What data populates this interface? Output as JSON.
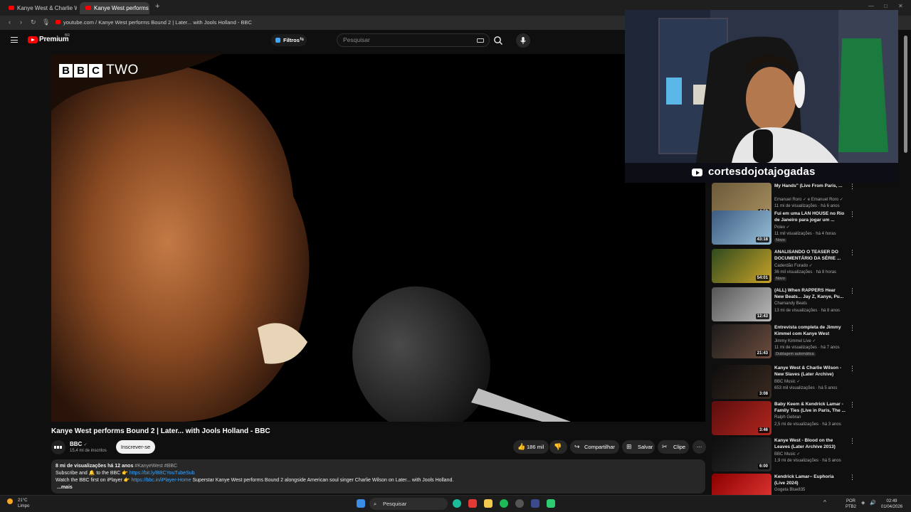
{
  "browser": {
    "tabs": [
      {
        "label": "Kanye West & Charlie Wi"
      },
      {
        "label": "Kanye West performs Bo"
      }
    ],
    "new_tab": "+",
    "url": "youtube.com / Kanye West performs Bound 2 | Later... with Jools Holland - BBC"
  },
  "header": {
    "logo_text": "Premium",
    "logo_region": "BR",
    "filter_label": "Filtros",
    "search_placeholder": "Pesquisar"
  },
  "video": {
    "overlay_logo_letters": [
      "B",
      "B",
      "C"
    ],
    "overlay_logo_suffix": "TWO",
    "title": "Kanye West performs Bound 2 | Later... with Jools Holland - BBC"
  },
  "webcam": {
    "channel_name": "cortesdojotajogadas"
  },
  "channel": {
    "name": "BBC",
    "verified": "✓",
    "subscribers": "15,4 mi de inscritos",
    "subscribe_label": "Inscrever-se"
  },
  "actions": {
    "likes": "186 mil",
    "share": "Compartilhar",
    "save": "Salvar",
    "clip": "Clipe",
    "more": "⋯"
  },
  "description": {
    "views_age": "8 mi de visualizações  há 12 anos",
    "hashtags": "#KanyeWest #BBC",
    "line2_prefix": "Subscribe and 🔔 to the BBC 👉",
    "line2_link": "https://bit.ly/BBCYouTubeSub",
    "line3_prefix": "Watch the BBC first on iPlayer 👉",
    "line3_link": "https://bbc.in/iPlayer-Home",
    "line3_suffix": "Superstar Kanye West performs Bound 2 alongside American soul singer Charlie Wilson on Later... with Jools Holland.",
    "more": "...mais"
  },
  "recommendations": [
    {
      "title": "My Hands\" (Live From Paris, ...",
      "channel": "Emanuel Roro ✓ e Emanuel Roro ✓",
      "views": "11 mi de visualizações · há 6 anos",
      "badge": "",
      "duration": "4:59",
      "colors": [
        "#6b5a3a",
        "#a58d5d"
      ]
    },
    {
      "title": "Fui em uma LAN HOUSE no Rio de Janeiro para jogar um ...",
      "channel": "Polex ✓",
      "views": "11 mil visualizações · há 4 horas",
      "badge": "Novo",
      "duration": "43:18",
      "colors": [
        "#3d5a80",
        "#98c1d9"
      ]
    },
    {
      "title": "ANALISANDO O TEASER DO DOCUMENTÁRIO DA SÉRIE ...",
      "channel": "Caderdão Furado ✓",
      "views": "36 mil visualizações · há 8 horas",
      "badge": "Novo",
      "duration": "54:01",
      "colors": [
        "#2e4a1e",
        "#c9a227"
      ]
    },
    {
      "title": "(ALL) When RAPPERS Hear New Beats... Jay Z, Kanye, Pu...",
      "channel": "Chamandy Beats",
      "views": "13 mi de visualizações · há 8 anos",
      "badge": "",
      "duration": "12:43",
      "colors": [
        "#555555",
        "#bbbbbb"
      ]
    },
    {
      "title": "Entrevista completa de Jimmy Kimmel com Kanye West",
      "channel": "Jimmy Kimmel Live ✓",
      "views": "11 mi de visualizações · há 7 anos",
      "badge": "Dublagem automática",
      "duration": "21:43",
      "colors": [
        "#1a1a1a",
        "#6d4c3d"
      ]
    },
    {
      "title": "Kanye West & Charlie Wilson - New Slaves (Later Archive)",
      "channel": "BBC Music ✓",
      "views": "653 mil visualizações · há 5 anos",
      "badge": "",
      "duration": "3:08",
      "colors": [
        "#0d0d0d",
        "#3a2a20"
      ]
    },
    {
      "title": "Baby Keem & Kendrick Lamar - Family Ties (Live in Paris, The ...",
      "channel": "Ralph Gebran",
      "views": "2,5 mi de visualizações · há 3 anos",
      "badge": "",
      "duration": "3:46",
      "colors": [
        "#5a0d0d",
        "#b3261e"
      ]
    },
    {
      "title": "Kanye West - Blood on the Leaves (Later Archive 2013)",
      "channel": "BBC Music ✓",
      "views": "1,9 mi de visualizações · há 5 anos",
      "badge": "",
      "duration": "6:00",
      "colors": [
        "#0d0d0d",
        "#2e2e2e"
      ]
    },
    {
      "title": "Kendrick Lamar-- Euphoria (Live 2024)",
      "channel": "Gogeta Blue835",
      "views": "",
      "badge": "",
      "duration": "",
      "colors": [
        "#8b0000",
        "#e53935"
      ]
    }
  ],
  "taskbar": {
    "temperature": "21°C",
    "weather": "Limpo",
    "search_label": "Pesquisar",
    "lang": "POR",
    "layout": "PTB2",
    "time": "02:49",
    "date": "01/04/2026"
  },
  "colors": {
    "youtube_red": "#ff0000",
    "link_blue": "#3ea6ff",
    "background": "#0f0f0f"
  }
}
